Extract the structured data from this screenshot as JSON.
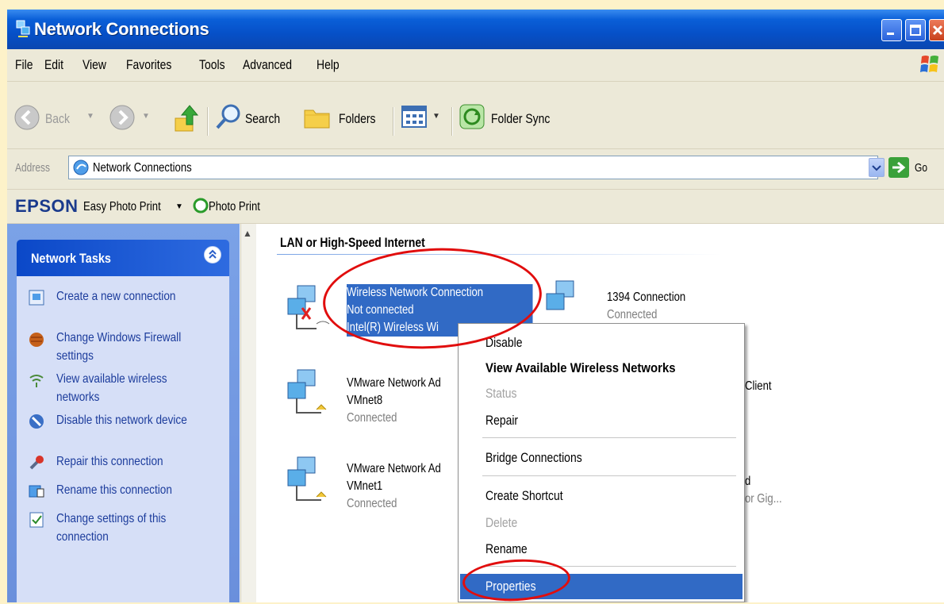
{
  "window": {
    "title": "Network Connections"
  },
  "menu": [
    "File",
    "Edit",
    "View",
    "Favorites",
    "Tools",
    "Advanced",
    "Help"
  ],
  "toolbar": {
    "back": "Back",
    "search": "Search",
    "folders": "Folders",
    "folder_sync": "Folder Sync"
  },
  "address": {
    "label": "Address",
    "value": "Network Connections",
    "go": "Go"
  },
  "epson": {
    "logo": "EPSON",
    "easy_photo_print": "Easy Photo Print",
    "photo_print": "Photo Print"
  },
  "tasks": {
    "title": "Network Tasks",
    "items": [
      {
        "label": "Create a new connection"
      },
      {
        "label": "Change Windows Firewall settings"
      },
      {
        "label": "View available wireless networks"
      },
      {
        "label": "Disable this network device"
      },
      {
        "label": "Repair this connection"
      },
      {
        "label": "Rename this connection"
      },
      {
        "label": "Change settings of this connection"
      }
    ]
  },
  "main": {
    "group_title": "LAN or High-Speed Internet",
    "connections": [
      {
        "name": "Wireless Network Connection",
        "status": "Not connected",
        "device": "Intel(R) Wireless Wi"
      },
      {
        "name": "1394 Connection",
        "status": "Connected"
      },
      {
        "name": "VMware Network Ad",
        "status": "VMnet8",
        "device": "Connected"
      },
      {
        "name": "VMware Network Ad",
        "status": "VMnet1",
        "device": "Connected"
      },
      {
        "partial_1": "Client"
      },
      {
        "partial_1": "d",
        "partial_2": "or Gig..."
      }
    ]
  },
  "context_menu": {
    "items": [
      {
        "label": "Disable",
        "state": "normal"
      },
      {
        "label": "View Available Wireless Networks",
        "state": "bold"
      },
      {
        "label": "Status",
        "state": "disabled"
      },
      {
        "label": "Repair",
        "state": "normal"
      },
      {
        "label": "Bridge Connections",
        "state": "normal"
      },
      {
        "label": "Create Shortcut",
        "state": "normal"
      },
      {
        "label": "Delete",
        "state": "disabled"
      },
      {
        "label": "Rename",
        "state": "normal"
      },
      {
        "label": "Properties",
        "state": "highlighted"
      }
    ]
  },
  "colors": {
    "selection": "#316ac5",
    "annotation": "#e10d0d",
    "titlebar": "#0650c8"
  }
}
